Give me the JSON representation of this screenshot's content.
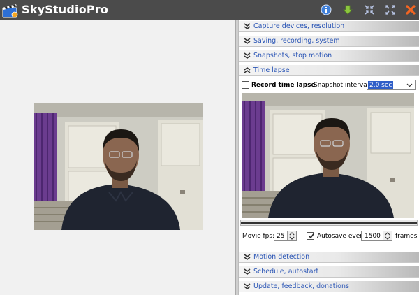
{
  "app": {
    "title": "SkyStudioPro"
  },
  "titlebar_icons": [
    {
      "name": "info-icon",
      "color": "#3f7fd8"
    },
    {
      "name": "download-arrow-icon",
      "color": "#8cc63f"
    },
    {
      "name": "shrink-icon",
      "color": "#9fb0d6"
    },
    {
      "name": "fullscreen-icon",
      "color": "#9fb0d6"
    },
    {
      "name": "close-icon",
      "color": "#f26522"
    }
  ],
  "sections": {
    "capture": "Capture devices, resolution",
    "saving": "Saving, recording, system",
    "snapshots": "Snapshots, stop motion",
    "timelapse": "Time lapse",
    "motion": "Motion detection",
    "schedule": "Schedule, autostart",
    "update": "Update, feedback, donations"
  },
  "timelapse": {
    "record_label": "Record time lapse",
    "record_checked": false,
    "interval_label": "Snapshot interval:",
    "interval_value": "2.0 sec",
    "fps_label": "Movie fps:",
    "fps_value": "25",
    "autosave_label": "Autosave every",
    "autosave_checked": true,
    "autosave_value": "1500",
    "frames_label": "frames"
  },
  "colors": {
    "titlebar": "#4b4b4b",
    "section_text": "#2a55b5",
    "selection": "#2f5ec8"
  }
}
